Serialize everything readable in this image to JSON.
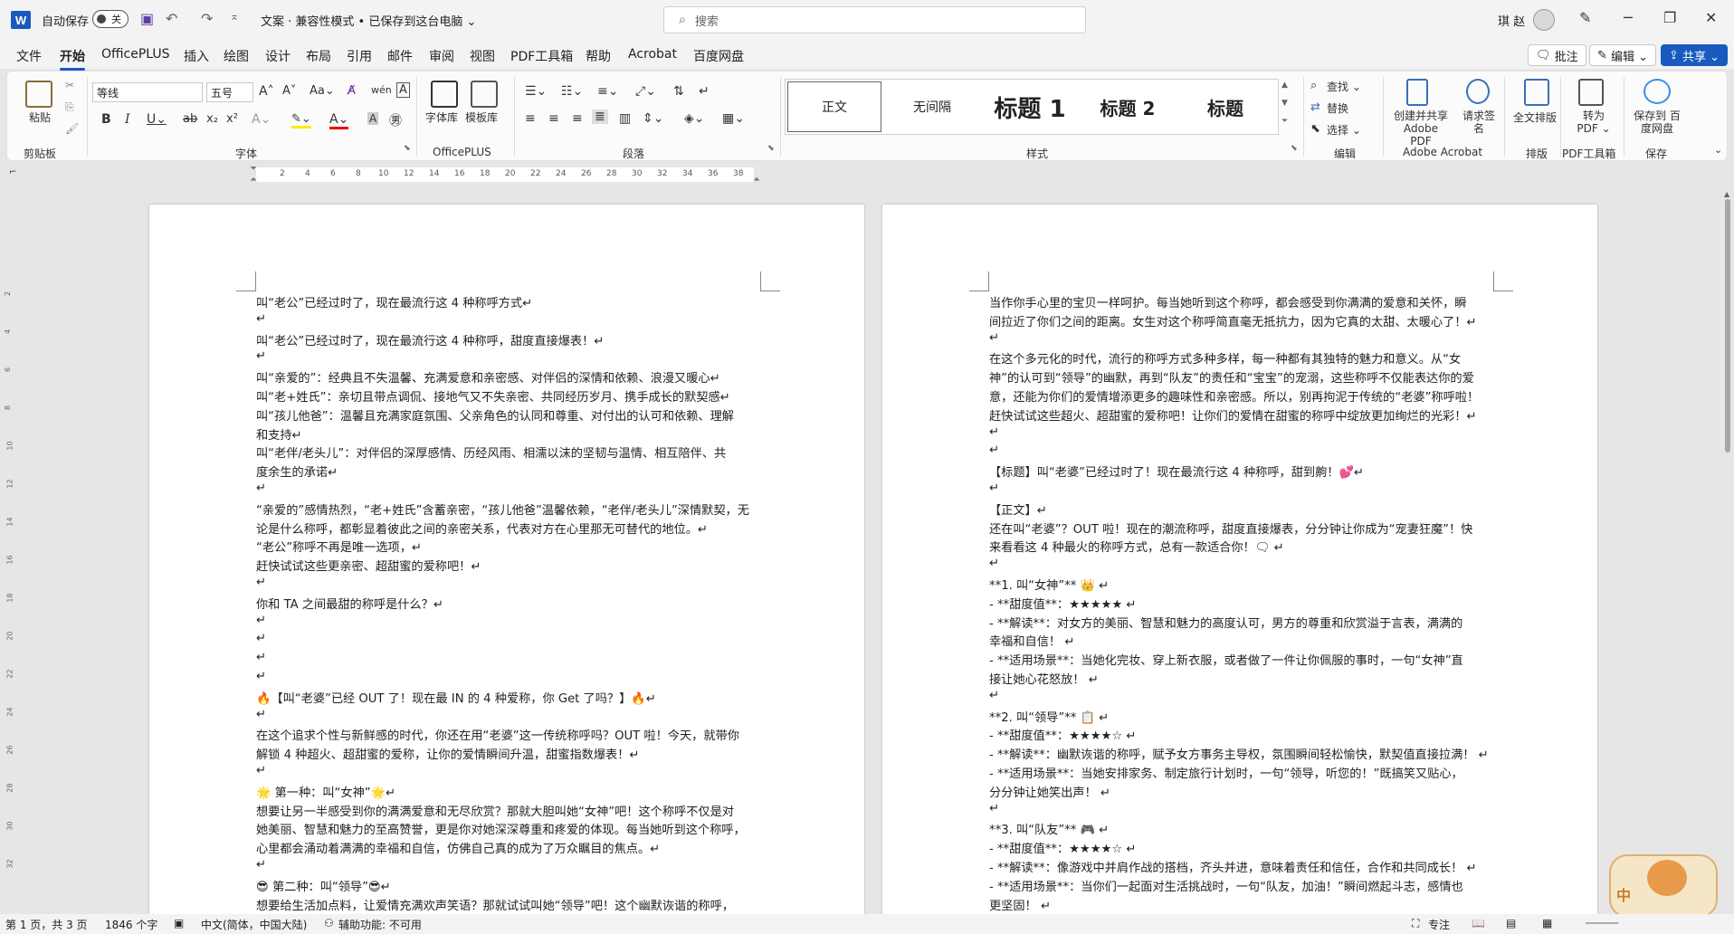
{
  "titlebar": {
    "app_icon": "W",
    "autosave_label": "自动保存",
    "autosave_state": "关",
    "doc_title": "文案 · 兼容性模式 • 已保存到这台电脑 ⌄",
    "search_placeholder": "搜索",
    "user_name": "琪 赵",
    "icons": [
      "save-icon",
      "undo-icon",
      "redo-icon",
      "customize-icon",
      "pen-icon",
      "minimize-icon",
      "restore-icon",
      "close-icon"
    ]
  },
  "menu": {
    "items": [
      "文件",
      "开始",
      "OfficePLUS",
      "插入",
      "绘图",
      "设计",
      "布局",
      "引用",
      "邮件",
      "审阅",
      "视图",
      "PDF工具箱",
      "帮助",
      "Acrobat",
      "百度网盘"
    ],
    "active": "开始",
    "comment_btn": "批注",
    "edit_btn": "编辑 ⌄",
    "share_btn": "共享 ⌄"
  },
  "ribbon": {
    "clipboard": {
      "paste": "粘贴",
      "label": "剪贴板"
    },
    "font": {
      "name": "等线",
      "size": "五号",
      "label": "字体"
    },
    "officeplus": {
      "wordlib": "字体库",
      "templates": "模板库",
      "label": "OfficePLUS"
    },
    "paragraph": {
      "label": "段落"
    },
    "styles": {
      "items": [
        "正文",
        "无间隔",
        "标题 1",
        "标题 2",
        "标题"
      ],
      "label": "样式"
    },
    "editing": {
      "find": "查找 ⌄",
      "replace": "替换",
      "select": "选择 ⌄",
      "label": "编辑"
    },
    "acrobat": {
      "create_share": "创建并共享 Adobe PDF",
      "request_sign": "请求签名",
      "label": "Adobe Acrobat"
    },
    "layout": {
      "full": "全文排版",
      "label": "排版"
    },
    "pdf": {
      "convert": "转为 PDF ⌄",
      "label": "PDF工具箱"
    },
    "save": {
      "baidu": "保存到 百度网盘",
      "label": "保存"
    }
  },
  "ruler": {
    "numbers": [
      "2",
      "4",
      "6",
      "8",
      "10",
      "12",
      "14",
      "16",
      "18",
      "20",
      "22",
      "24",
      "26",
      "28",
      "30",
      "32",
      "34",
      "36",
      "38"
    ]
  },
  "vruler": {
    "numbers": [
      "2",
      "4",
      "6",
      "8",
      "10",
      "12",
      "14",
      "16",
      "18",
      "20",
      "22",
      "24",
      "26",
      "28",
      "30",
      "32"
    ]
  },
  "page1": {
    "lines": [
      "叫“老公”已经过时了，现在最流行这 4 种称呼方式↵",
      "↵",
      "叫“老公”已经过时了，现在最流行这 4 种称呼，甜度直接爆表！↵",
      "↵",
      "叫“亲爱的”：经典且不失温馨、充满爱意和亲密感、对伴侣的深情和依赖、浪漫又暖心↵",
      "叫“老+姓氏”：亲切且带点调侃、接地气又不失亲密、共同经历岁月、携手成长的默契感↵",
      "叫“孩儿他爸”：温馨且充满家庭氛围、父亲角色的认同和尊重、对付出的认可和依赖、理解",
      "和支持↵",
      "叫“老伴/老头儿”：对伴侣的深厚感情、历经风雨、相濡以沫的坚韧与温情、相互陪伴、共",
      "度余生的承诺↵",
      "↵",
      "“亲爱的”感情热烈，“老+姓氏”含蓄亲密，“孩儿他爸”温馨依赖，“老伴/老头儿”深情默契，无",
      "论是什么称呼，都彰显着彼此之间的亲密关系，代表对方在心里那无可替代的地位。↵",
      "“老公”称呼不再是唯一选项，↵",
      "赶快试试这些更亲密、超甜蜜的爱称吧！↵",
      "↵",
      "你和 TA 之间最甜的称呼是什么？↵",
      "↵",
      "↵",
      "↵",
      "↵",
      "🔥【叫“老婆”已经 OUT 了！现在最 IN 的 4 种爱称，你 Get 了吗？】🔥↵",
      "↵",
      "在这个追求个性与新鲜感的时代，你还在用“老婆”这一传统称呼吗？OUT 啦！今天，就带你",
      "解锁 4 种超火、超甜蜜的爱称，让你的爱情瞬间升温，甜蜜指数爆表！↵",
      "↵",
      "🌟 第一种：叫“女神”🌟↵",
      "想要让另一半感受到你的满满爱意和无尽欣赏？那就大胆叫她“女神”吧！这个称呼不仅是对",
      "她美丽、智慧和魅力的至高赞誉，更是你对她深深尊重和疼爱的体现。每当她听到这个称呼，",
      "心里都会涌动着满满的幸福和自信，仿佛自己真的成为了万众瞩目的焦点。↵",
      "↵",
      "😎 第二种：叫“领导”😎↵",
      "想要给生活加点料，让爱情充满欢声笑语？那就试试叫她“领导”吧！这个幽默诙谐的称呼，"
    ]
  },
  "page2": {
    "lines": [
      "当作你手心里的宝贝一样呵护。每当她听到这个称呼，都会感受到你满满的爱意和关怀，瞬",
      "间拉近了你们之间的距离。女生对这个称呼简直毫无抵抗力，因为它真的太甜、太暖心了！↵",
      "↵",
      "在这个多元化的时代，流行的称呼方式多种多样，每一种都有其独特的魅力和意义。从“女",
      "神”的认可到“领导”的幽默，再到“队友”的责任和“宝宝”的宠溺，这些称呼不仅能表达你的爱",
      "意，还能为你们的爱情增添更多的趣味性和亲密感。所以，别再拘泥于传统的“老婆”称呼啦！",
      "赶快试试这些超火、超甜蜜的爱称吧！让你们的爱情在甜蜜的称呼中绽放更加绚烂的光彩！↵",
      "↵",
      "↵",
      "【标题】叫“老婆”已经过时了！现在最流行这 4 种称呼，甜到齁！💕↵",
      "↵",
      "【正文】↵",
      "还在叫“老婆”？OUT 啦！现在的潮流称呼，甜度直接爆表，分分钟让你成为“宠妻狂魔”！快",
      "来看看这 4 种最火的称呼方式，总有一款适合你！🗨 ↵",
      "↵",
      "**1. 叫“女神”** 👑 ↵",
      "- **甜度值**：★★★★★ ↵",
      "- **解读**：对女方的美丽、智慧和魅力的高度认可，男方的尊重和欣赏溢于言表，满满的",
      "幸福和自信！ ↵",
      "- **适用场景**：当她化完妆、穿上新衣服，或者做了一件让你佩服的事时，一句“女神”直",
      "接让她心花怒放！ ↵",
      "↵",
      "**2. 叫“领导”** 📋 ↵",
      "- **甜度值**：★★★★☆ ↵",
      "- **解读**：幽默诙谐的称呼，赋予女方事务主导权，氛围瞬间轻松愉快，默契值直接拉满！ ↵",
      "- **适用场景**：当她安排家务、制定旅行计划时，一句“领导，听您的！”既搞笑又贴心，",
      "分分钟让她笑出声！ ↵",
      "↵",
      "**3. 叫“队友”** 🎮 ↵",
      "- **甜度值**：★★★★☆ ↵",
      "- **解读**：像游戏中并肩作战的搭档，齐头并进，意味着责任和信任，合作和共同成长！ ↵",
      "- **适用场景**：当你们一起面对生活挑战时，一句“队友，加油！”瞬间燃起斗志，感情也",
      "更坚固！ ↵"
    ]
  },
  "status": {
    "page": "第 1 页，共 3 页",
    "words": "1846 个字",
    "lang": "中文(简体，中国大陆)",
    "access": "辅助功能: 不可用",
    "focus": "专注"
  }
}
